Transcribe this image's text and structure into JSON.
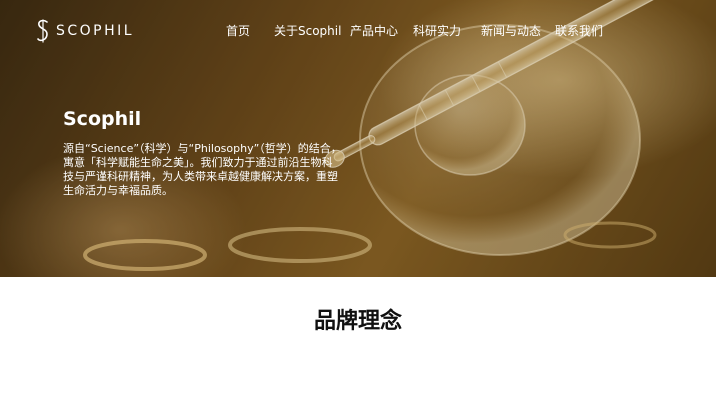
{
  "colors": {
    "hero_dark": "#3a2a12",
    "hero_gold": "#8c6526",
    "text_on_hero": "#ffffff",
    "heading": "#111111"
  },
  "brand": {
    "logo_icon": "s-monogram-icon",
    "name": "SCOPHIL"
  },
  "nav": {
    "items": [
      {
        "label": "首页"
      },
      {
        "label": "关于Scophil"
      },
      {
        "label": "产品中心"
      },
      {
        "label": "科研实力"
      },
      {
        "label": "新闻与动态"
      },
      {
        "label": "联系我们"
      }
    ]
  },
  "hero": {
    "title": "Scophil",
    "description": "源自“Science”（科学）与“Philosophy”（哲学）的结合，寓意「科学赋能生命之美」。我们致力于通过前沿生物科技与严谨科研精神，为人类带来卓越健康解决方案，重塑生命活力与幸福品质。"
  },
  "section": {
    "title": "品牌理念"
  }
}
